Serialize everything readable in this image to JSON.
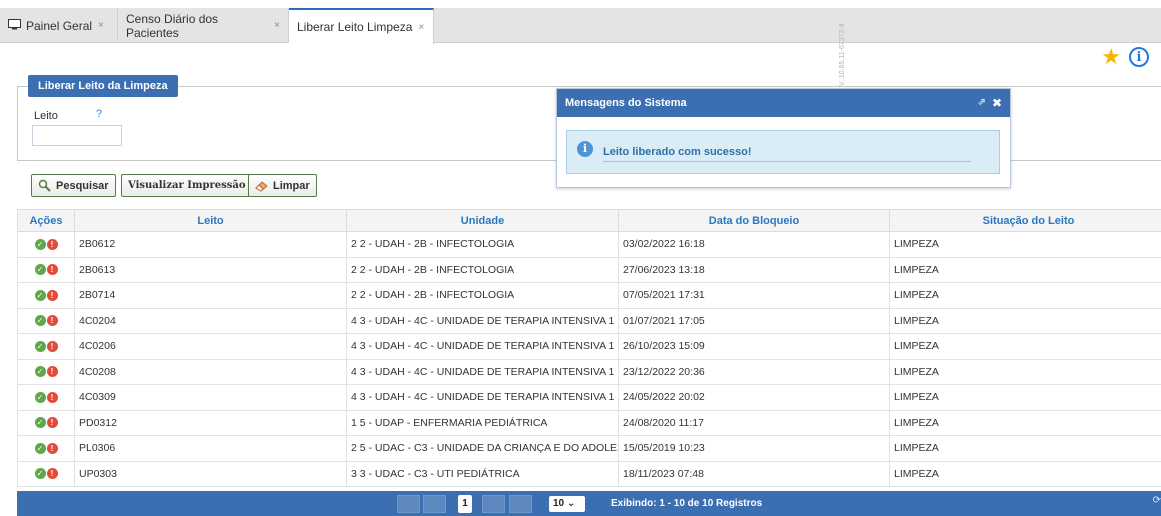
{
  "tabs": [
    {
      "label": "Painel Geral",
      "icon": "monitor-icon"
    },
    {
      "label": "Censo Diário dos Pacientes"
    },
    {
      "label": "Liberar Leito Limpeza",
      "active": true
    }
  ],
  "tab_close_glyph": "×",
  "version": "V. 10.65.11-67372-4",
  "panel": {
    "legend": "Liberar Leito da Limpeza",
    "field_label": "Leito",
    "help": "?",
    "field_value": ""
  },
  "buttons": {
    "search": "Pesquisar",
    "print": "Visualizar Impressão",
    "clear": "Limpar"
  },
  "table": {
    "headers": [
      "Ações",
      "Leito",
      "Unidade",
      "Data do Bloqueio",
      "Situação do Leito"
    ],
    "rows": [
      {
        "leito": "2B0612",
        "unidade": "2 2 - UDAH - 2B - INFECTOLOGIA",
        "data": "03/02/2022 16:18",
        "situacao": "LIMPEZA"
      },
      {
        "leito": "2B0613",
        "unidade": "2 2 - UDAH - 2B - INFECTOLOGIA",
        "data": "27/06/2023 13:18",
        "situacao": "LIMPEZA"
      },
      {
        "leito": "2B0714",
        "unidade": "2 2 - UDAH - 2B - INFECTOLOGIA",
        "data": "07/05/2021 17:31",
        "situacao": "LIMPEZA"
      },
      {
        "leito": "4C0204",
        "unidade": "4 3 - UDAH - 4C - UNIDADE DE TERAPIA INTENSIVA 1",
        "data": "01/07/2021 17:05",
        "situacao": "LIMPEZA"
      },
      {
        "leito": "4C0206",
        "unidade": "4 3 - UDAH - 4C - UNIDADE DE TERAPIA INTENSIVA 1",
        "data": "26/10/2023 15:09",
        "situacao": "LIMPEZA"
      },
      {
        "leito": "4C0208",
        "unidade": "4 3 - UDAH - 4C - UNIDADE DE TERAPIA INTENSIVA 1",
        "data": "23/12/2022 20:36",
        "situacao": "LIMPEZA"
      },
      {
        "leito": "4C0309",
        "unidade": "4 3 - UDAH - 4C - UNIDADE DE TERAPIA INTENSIVA 1",
        "data": "24/05/2022 20:02",
        "situacao": "LIMPEZA"
      },
      {
        "leito": "PD0312",
        "unidade": "1 5 - UDAP - ENFERMARIA PEDIÁTRICA",
        "data": "24/08/2020 11:17",
        "situacao": "LIMPEZA"
      },
      {
        "leito": "PL0306",
        "unidade": "2 5 - UDAC - C3 - UNIDADE DA CRIANÇA E DO ADOLES",
        "data": "15/05/2019 10:23",
        "situacao": "LIMPEZA"
      },
      {
        "leito": "UP0303",
        "unidade": "3 3 - UDAC - C3 - UTI PEDIÁTRICA",
        "data": "18/11/2023 07:48",
        "situacao": "LIMPEZA"
      }
    ]
  },
  "pager": {
    "current_page": "1",
    "page_size": "10",
    "info": "Exibindo: 1 - 10 de 10 Registros"
  },
  "dialog": {
    "title": "Mensagens do Sistema",
    "message": "Leito liberado com sucesso!"
  },
  "colors": {
    "header_blue": "#3b6fb1",
    "link_blue": "#2a77c4",
    "ok_green": "#5ea84a",
    "warn_red": "#e14c3a",
    "star": "#f5b400"
  }
}
